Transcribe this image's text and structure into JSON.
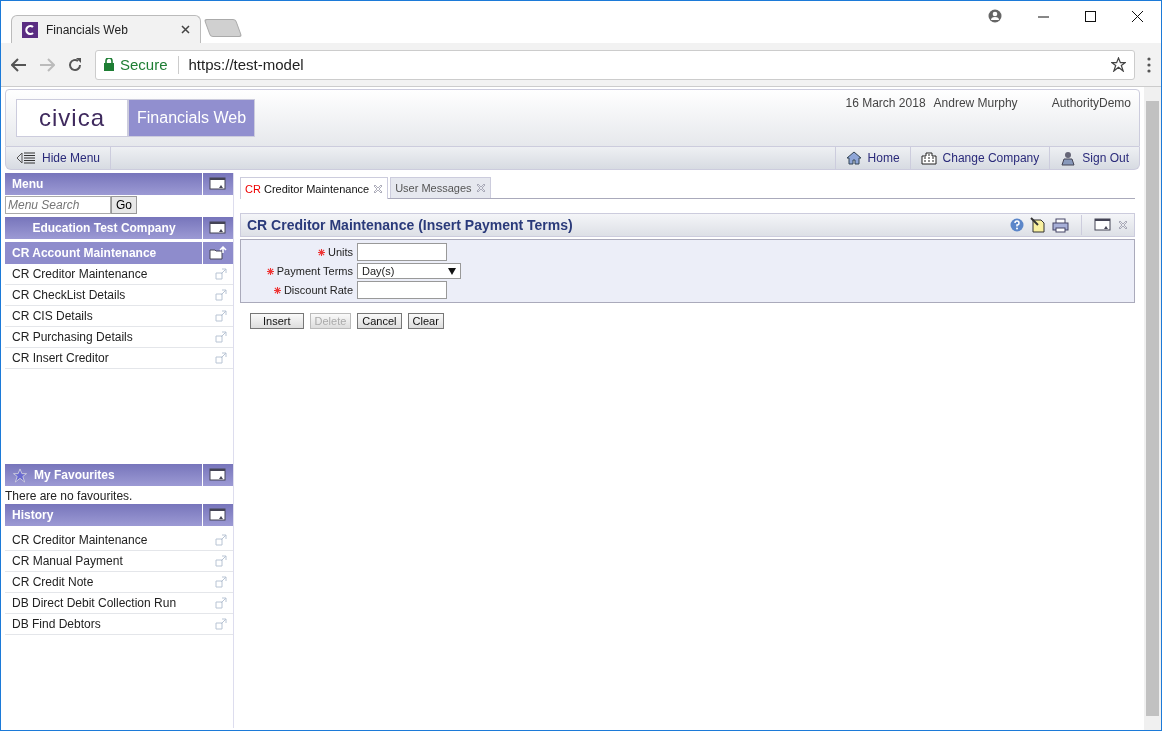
{
  "browser": {
    "tabs": [
      {
        "title": "Financials Web",
        "selected": true
      }
    ],
    "address": {
      "security": "Secure",
      "url": "https://test-model"
    }
  },
  "header": {
    "logo": "civica",
    "product": "Financials Web",
    "date": "16 March 2018",
    "user": "Andrew Murphy",
    "authority": "AuthorityDemo"
  },
  "toolbar": {
    "hide_menu": "Hide Menu",
    "links": [
      {
        "label": "Home",
        "kind": "home"
      },
      {
        "label": "Change Company",
        "kind": "company"
      },
      {
        "label": "Sign Out",
        "kind": "signout"
      }
    ]
  },
  "sidebar": {
    "menu_title": "Menu",
    "search_placeholder": "Menu Search",
    "go": "Go",
    "company": "Education Test Company",
    "section": "CR Account Maintenance",
    "items": [
      "CR Creditor Maintenance",
      "CR CheckList Details",
      "CR CIS Details",
      "CR Purchasing Details",
      "CR Insert Creditor"
    ],
    "favourites_title": "My Favourites",
    "favourites_empty": "There are no favourites.",
    "history_title": "History",
    "history": [
      "CR Creditor Maintenance",
      "CR Manual Payment",
      "CR Credit Note",
      "DB Direct Debit Collection Run",
      "DB Find Debtors"
    ]
  },
  "content": {
    "tabs": [
      {
        "prefix": "CR",
        "label": "Creditor Maintenance",
        "selected": true
      },
      {
        "label": "User Messages",
        "selected": false
      }
    ],
    "title": "CR Creditor Maintenance (Insert Payment Terms)",
    "fields": [
      {
        "label": "Units",
        "required": true,
        "kind": "text"
      },
      {
        "label": "Payment Terms",
        "required": true,
        "kind": "select",
        "value": "Day(s)"
      },
      {
        "label": "Discount Rate",
        "required": true,
        "kind": "text"
      }
    ],
    "buttons": [
      {
        "label": "Insert",
        "disabled": false
      },
      {
        "label": "Delete",
        "disabled": true
      },
      {
        "label": "Cancel",
        "disabled": false
      },
      {
        "label": "Clear",
        "disabled": false
      }
    ]
  }
}
